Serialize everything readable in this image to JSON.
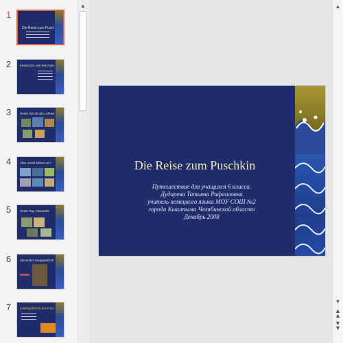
{
  "thumbnails": [
    {
      "number": "1",
      "title": "Die Reise zum Puschkin"
    },
    {
      "number": "2",
      "title": "Kennst Du, wie reist man"
    },
    {
      "number": "3",
      "title": "Unser Ziel ist das Lehrwerk"
    },
    {
      "number": "4",
      "title": "Aber womit fahren wir?"
    },
    {
      "number": "5",
      "title": "Unser Tag, Alexander"
    },
    {
      "number": "6",
      "title": "Alexander Sergejewitsch Puschkin"
    },
    {
      "number": "7",
      "title": "Lieblingsfarben der Puschkins"
    }
  ],
  "slide": {
    "title": "Die Reise zum Puschkin",
    "subtitle_lines": [
      "Путешествие для учащихся 6 класса.",
      "Дударева Татьяна Рафаиловна",
      "учитель немецкого языка МОУ СОШ №2",
      "города Кыштыма Челябинской области",
      "Декабрь 2008"
    ]
  },
  "scrollbar_icons": {
    "up": "chevron-up-icon",
    "down": "chevron-down-icon",
    "prev_slide": "double-chevron-up-icon",
    "next_slide": "double-chevron-down-icon"
  },
  "colors": {
    "slide_background": "#1f2d6b",
    "title_text": "#f2e7b5",
    "active_thumbnail_border": "#e0614a"
  }
}
